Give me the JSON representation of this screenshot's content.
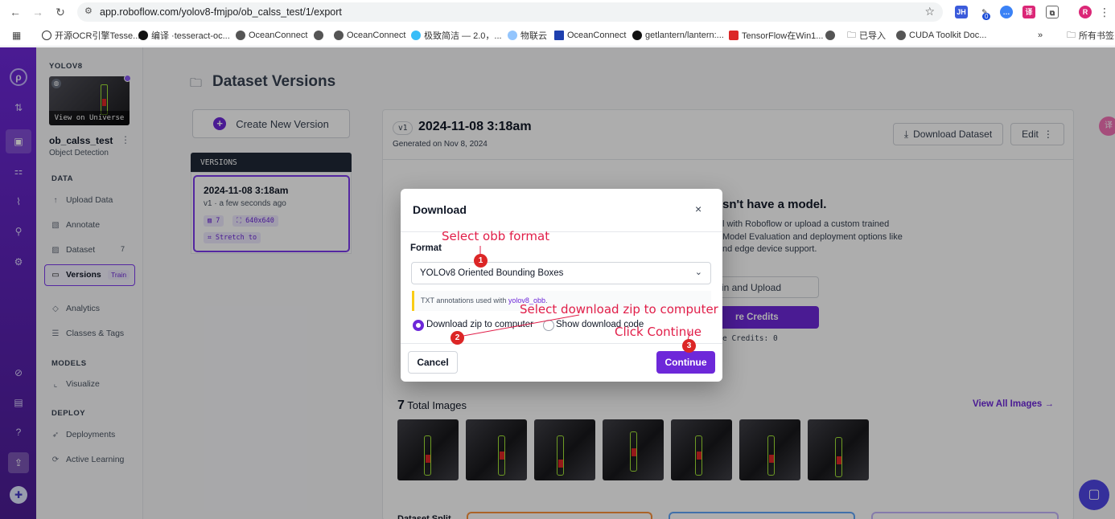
{
  "browser": {
    "url": "app.roboflow.com/yolov8-fmjpo/ob_calss_test/1/export",
    "ext_badge": "0",
    "profile": "R"
  },
  "bookmarks": [
    "开源OCR引擎Tesse...",
    "编译 ·tesseract-oc...",
    "OceanConnect",
    "OceanConnect",
    "极致简洁 — 2.0，...",
    "物联云",
    "OceanConnect",
    "getlantern/lantern:...",
    "TensorFlow在Win1...",
    "已导入",
    "CUDA Toolkit Doc...",
    "所有书签"
  ],
  "sidebar": {
    "workspace": "YOLOV8",
    "view_universe": "View on Universe",
    "project_name": "ob_calss_test",
    "project_type": "Object Detection",
    "data_header": "DATA",
    "upload": "Upload Data",
    "annotate": "Annotate",
    "dataset": "Dataset",
    "dataset_count": "7",
    "versions": "Versions",
    "train_badge": "Train",
    "analytics": "Analytics",
    "classes": "Classes & Tags",
    "models_header": "MODELS",
    "visualize": "Visualize",
    "deploy_header": "DEPLOY",
    "deployments": "Deployments",
    "active_learning": "Active Learning"
  },
  "main": {
    "page_title": "Dataset Versions",
    "create_version": "Create New Version",
    "versions_header": "VERSIONS",
    "version_item": {
      "date": "2024-11-08 3:18am",
      "sub": "v1 · a few seconds ago",
      "images": "7",
      "size": "640x640",
      "stretch": "Stretch to"
    },
    "version_badge": "v1",
    "version_title": "2024-11-08 3:18am",
    "generated": "Generated on Nov 8, 2024",
    "download_dataset": "Download Dataset",
    "edit": "Edit",
    "no_model_title": "sn't have a model.",
    "no_model_text1": "l with Roboflow or upload a custom trained",
    "no_model_text2": "Model Evaluation and deployment options like",
    "no_model_text3": "nd edge device support.",
    "train_upload": "in and Upload",
    "credits_btn": "re Credits",
    "credits_text": "e Credits:",
    "credits_val": "0",
    "total_images_num": "7",
    "total_images_label": "Total Images",
    "view_all": "View All Images",
    "dataset_split": "Dataset Split"
  },
  "modal": {
    "title": "Download",
    "format_label": "Format",
    "format_value": "YOLOv8 Oriented Bounding Boxes",
    "info_text": "TXT annotations used with",
    "info_link": "yolov8_obb",
    "opt_zip": "Download zip to computer",
    "opt_code": "Show download code",
    "cancel": "Cancel",
    "continue": "Continue"
  },
  "annotations": {
    "a1": "Select obb format",
    "a2": "Select download zip to computer",
    "a3": "Click Continue",
    "n1": "1",
    "n2": "2",
    "n3": "3"
  },
  "colors": {
    "primary": "#6d28d9",
    "annotation": "#e11d48",
    "badge_red": "#dc2626"
  }
}
